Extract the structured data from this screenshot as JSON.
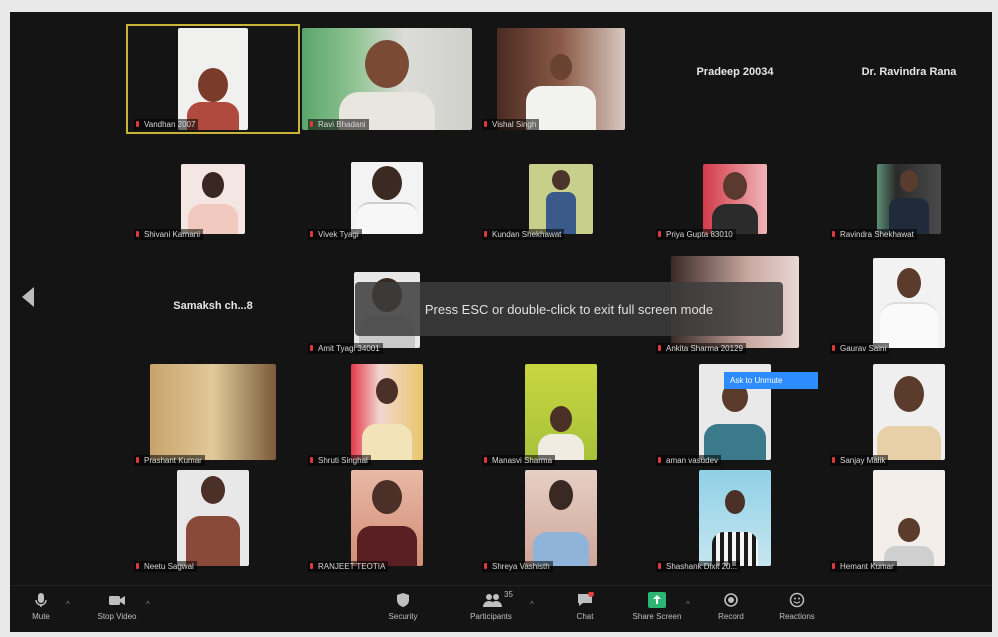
{
  "toast": "Press ESC or double-click to exit full screen mode",
  "badge": "Ask to Unmute",
  "toolbar": {
    "mute": "Mute",
    "stop_video": "Stop Video",
    "security": "Security",
    "participants": "Participants",
    "participants_count": "35",
    "chat": "Chat",
    "share_screen": "Share Screen",
    "record": "Record",
    "reactions": "Reactions"
  },
  "tiles": [
    {
      "name": "Vandhan 2007",
      "type": "video",
      "speaker": true
    },
    {
      "name": "Ravi Bhadani",
      "type": "video"
    },
    {
      "name": "Vishal Singh",
      "type": "video"
    },
    {
      "name": "Pradeep 20034",
      "type": "noname"
    },
    {
      "name": "Dr. Ravindra Rana",
      "type": "noname"
    },
    {
      "name": "Shivani Karnani",
      "type": "video"
    },
    {
      "name": "Vivek Tyagi",
      "type": "video"
    },
    {
      "name": "Kundan Shekhawat",
      "type": "video"
    },
    {
      "name": "Priya Gupta 83010",
      "type": "video"
    },
    {
      "name": "Ravindra Shekhawat",
      "type": "video"
    },
    {
      "name": "Samaksh ch...8",
      "type": "noname"
    },
    {
      "name": "Amit Tyagi 34001",
      "type": "video"
    },
    {
      "name": "",
      "type": "blank"
    },
    {
      "name": "Ankita Sharma 20129",
      "type": "video"
    },
    {
      "name": "Gaurav Saini",
      "type": "video"
    },
    {
      "name": "Prashant Kumar",
      "type": "video"
    },
    {
      "name": "Shruti Singhal",
      "type": "video"
    },
    {
      "name": "Manasvi Sharma",
      "type": "video"
    },
    {
      "name": "aman vasudev",
      "type": "video"
    },
    {
      "name": "Sanjay Malik",
      "type": "video"
    },
    {
      "name": "Neetu Sagwal",
      "type": "video"
    },
    {
      "name": "RANJEET TEOTIA",
      "type": "video"
    },
    {
      "name": "Shreya Vashisth",
      "type": "video"
    },
    {
      "name": "Shashank Dixit 20...",
      "type": "video"
    },
    {
      "name": "Hemant Kumar",
      "type": "video"
    }
  ],
  "colors": {
    "bg": "#141414",
    "speaker_outline": "#c8b43a",
    "mic_off": "#d93b3b",
    "share_green": "#2bb673",
    "badge_blue": "#2d8cff"
  }
}
